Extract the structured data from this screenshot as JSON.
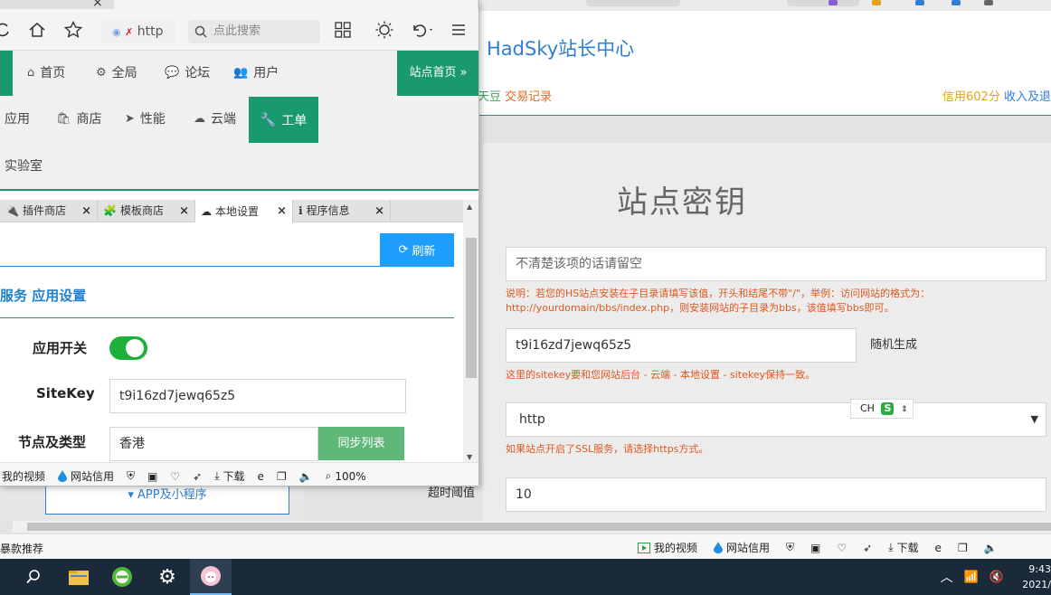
{
  "background": {
    "brand": "HadSky站长中心",
    "header_left_links": [
      "天豆",
      "交易记录"
    ],
    "header_right_links": [
      "信用602分",
      "收入及退"
    ],
    "page_title": "站点密钥",
    "dir_placeholder": "不清楚该项的话请留空",
    "dir_help_1": "说明：若您的HS站点安装在子目录请填写该值，开头和结尾不带\"/\"，举例：访问网站的格式为：",
    "dir_help_2": "http://yourdomain/bbs/index.php，则安装网站的子目录为bbs，该值填写bbs即可。",
    "sitekey_value": "t9i16zd7jewq65z5",
    "random_label": "随机生成",
    "sitekey_help": "这里的sitekey要和您网站后台 - 云端 - 本地设置 - sitekey保持一致。",
    "protocol_value": "http",
    "protocol_help": "如果站点开启了SSL服务，请选择https方式。",
    "timeout_label": "超时阈值",
    "timeout_value": "10",
    "app_button": "▾ APP及小程序",
    "ime": "CH",
    "status_left": "暴款推荐",
    "status_items": [
      "我的视频",
      "网站信用",
      "下载"
    ]
  },
  "foreground": {
    "url": "http",
    "search_placeholder": "点此搜索",
    "nav_row1": [
      "首页",
      "全局",
      "论坛",
      "用户"
    ],
    "site_home": "站点首页 »",
    "nav_row2": [
      "应用",
      "商店",
      "性能",
      "云端"
    ],
    "nav_work": "工单",
    "nav_row3": "实验室",
    "subtabs": [
      "插件商店",
      "模板商店",
      "本地设置",
      "程序信息"
    ],
    "refresh": "刷新",
    "section_title": "云服务 应用设置",
    "label_switch": "应用开关",
    "label_sitekey": "SiteKey",
    "sitekey_value": "t9i16zd7jewq65z5",
    "label_node": "节点及类型",
    "node_value": "香港",
    "sync_button": "同步列表",
    "status_items": [
      "我的视频",
      "网站信用",
      "下载"
    ],
    "zoom": "100%"
  },
  "taskbar": {
    "time": "9:43",
    "date": "2021/"
  },
  "colors": {
    "accent_green": "#1a9970",
    "link_blue": "#2e7ed3",
    "refresh_blue": "#1e9fff",
    "warn_orange": "#e0581f",
    "toggle_green": "#1db03b"
  }
}
